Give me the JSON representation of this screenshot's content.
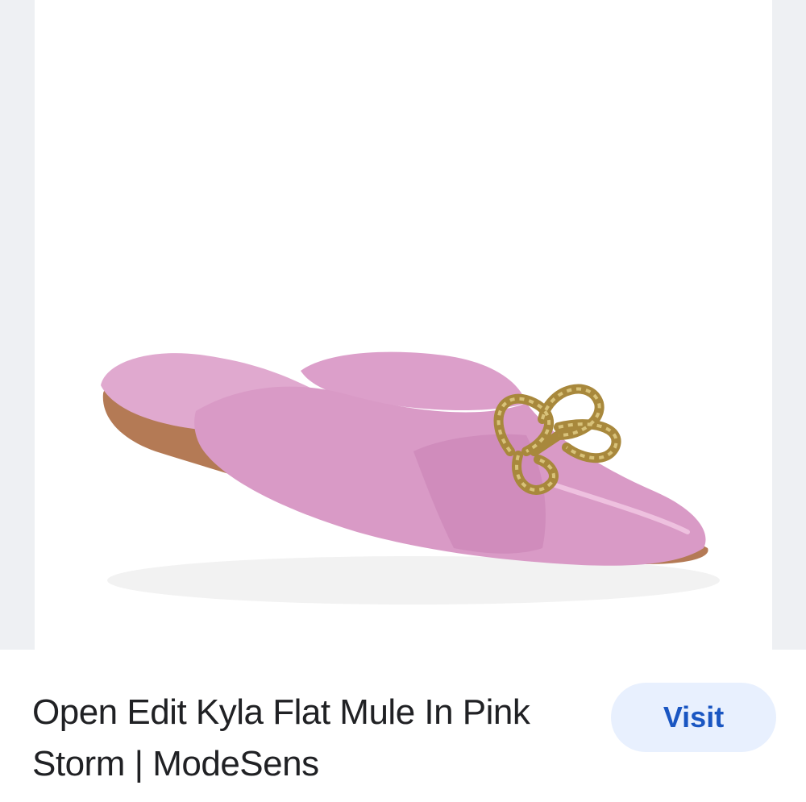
{
  "product": {
    "title": "Open Edit Kyla Flat Mule In Pink Storm | ModeSens",
    "image_subject": "pink pointed-toe flat mule with gold rope bow",
    "colors": {
      "shoe_pink": "#d99ac6",
      "shoe_pink_dark": "#c982b4",
      "sole_tan": "#b47a55",
      "hardware_gold": "#a8883c"
    }
  },
  "actions": {
    "visit_label": "Visit",
    "visit_color": "#1a56c2",
    "visit_bg": "#e8f0fe"
  }
}
